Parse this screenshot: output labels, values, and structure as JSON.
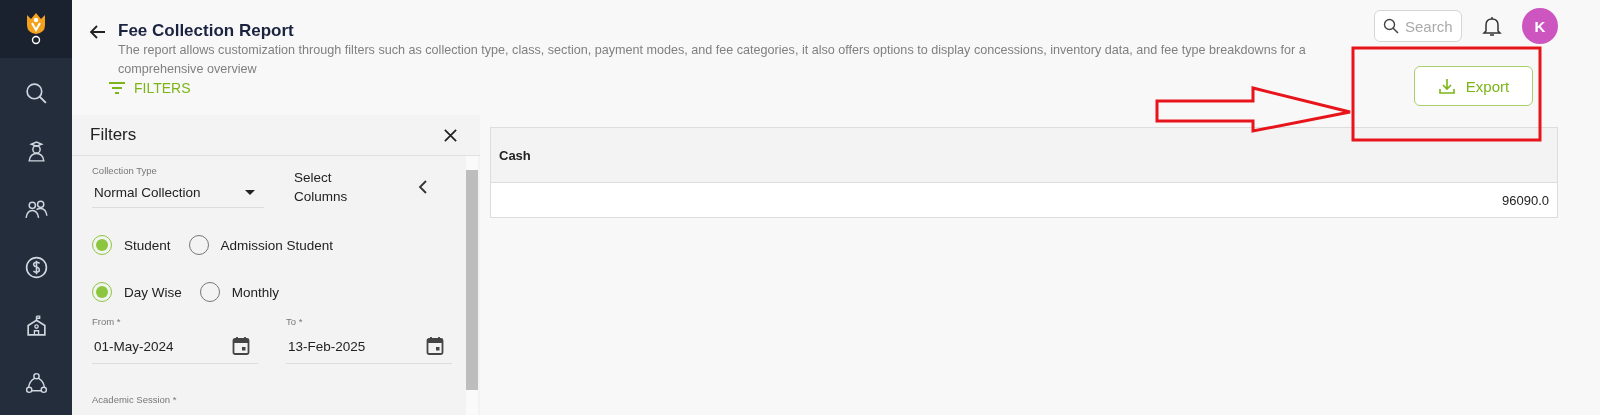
{
  "header": {
    "title": "Fee Collection Report",
    "description": "The report allows customization through filters such as collection type, class, section, payment modes, and fee categories, it also offers options to display concessions, inventory data, and fee type breakdowns for a comprehensive overview",
    "filters_button": "FILTERS"
  },
  "search": {
    "placeholder": "Search"
  },
  "avatar": {
    "initial": "K"
  },
  "export_button": "Export",
  "filters_panel": {
    "title": "Filters",
    "collection_type": {
      "label": "Collection Type",
      "value": "Normal Collection"
    },
    "select_columns": "Select Columns",
    "radio_groups": [
      [
        {
          "label": "Student",
          "selected": true
        },
        {
          "label": "Admission Student",
          "selected": false
        }
      ],
      [
        {
          "label": "Day Wise",
          "selected": true
        },
        {
          "label": "Monthly",
          "selected": false
        }
      ]
    ],
    "dates": [
      {
        "label": "From *",
        "value": "01-May-2024"
      },
      {
        "label": "To *",
        "value": "13-Feb-2025"
      }
    ],
    "academic_session": {
      "label": "Academic Session *"
    }
  },
  "table": {
    "columns": [
      "Cash"
    ],
    "rows": [
      [
        "96090.0"
      ]
    ]
  }
}
